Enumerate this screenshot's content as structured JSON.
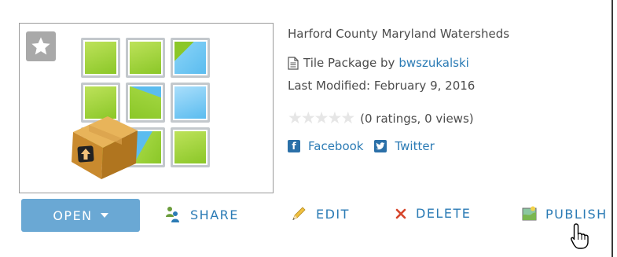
{
  "item": {
    "title": "Harford County Maryland Watersheds",
    "type_prefix": "Tile Package by",
    "owner": "bwszukalski",
    "last_modified": "Last Modified: February 9, 2016",
    "rating": {
      "stars_filled": 0,
      "stars_total": 5,
      "text": "(0 ratings, 0 views)"
    },
    "social": {
      "facebook": "Facebook",
      "twitter": "Twitter"
    }
  },
  "actions": {
    "open": "OPEN",
    "share": "SHARE",
    "edit": "EDIT",
    "delete": "DELETE",
    "publish": "PUBLISH"
  },
  "icons": {
    "favorite": "star-icon",
    "document": "document-icon",
    "package": "package-box-icon",
    "share": "share-people-icon",
    "edit": "pencil-icon",
    "delete": "x-icon",
    "publish": "publish-map-icon",
    "cursor": "hand-pointer-icon"
  },
  "colors": {
    "accent": "#2b7bb5",
    "open_button": "#6aa8d4",
    "delete_icon": "#d6452b",
    "star_empty": "#e6e6e6"
  }
}
